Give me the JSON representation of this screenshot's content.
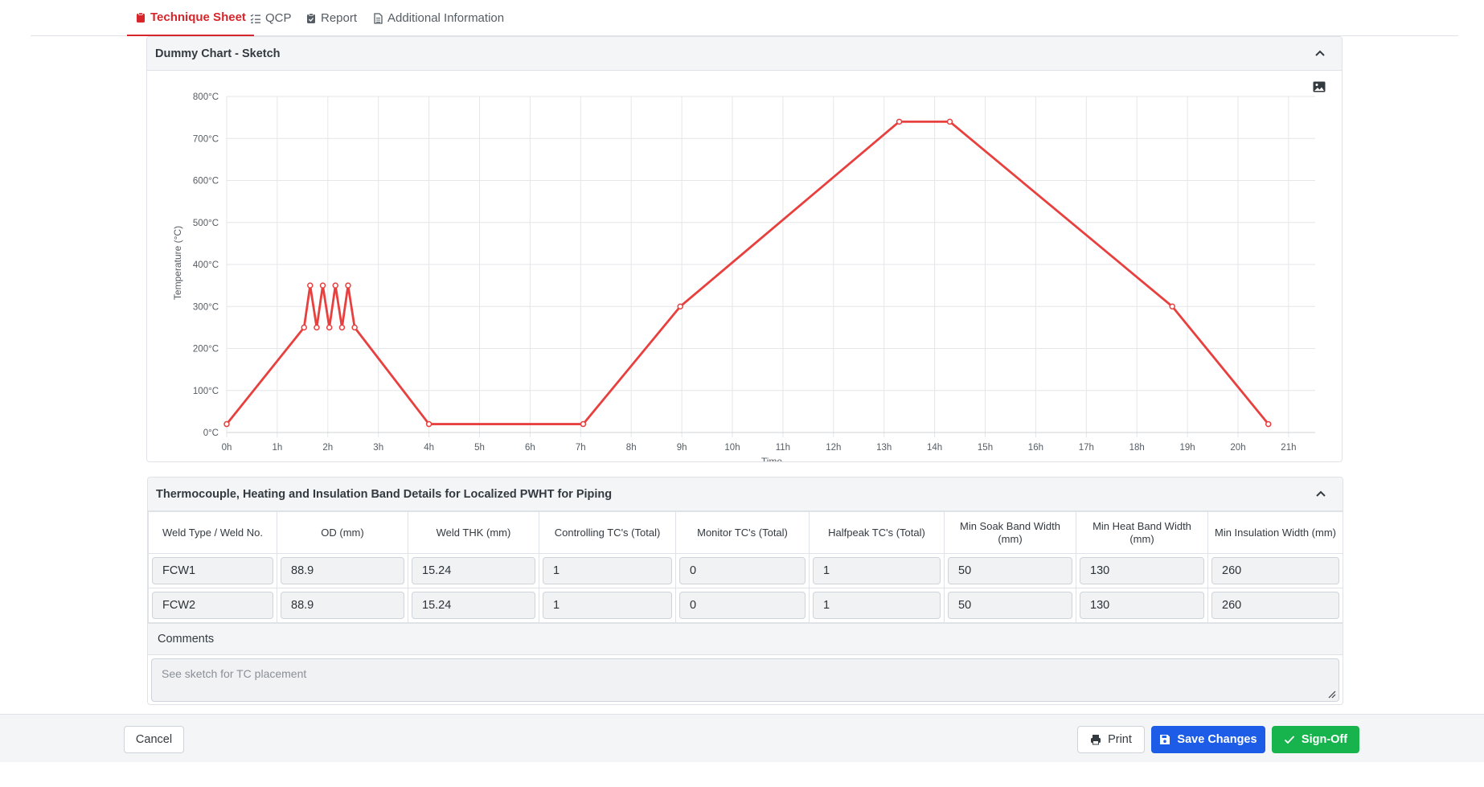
{
  "tabs": [
    {
      "label": "Technique Sheet",
      "icon": "clipboard-icon",
      "active": true
    },
    {
      "label": "QCP",
      "icon": "list-check-icon",
      "active": false
    },
    {
      "label": "Report",
      "icon": "clipboard-check-icon",
      "active": false
    },
    {
      "label": "Additional Information",
      "icon": "file-text-icon",
      "active": false
    }
  ],
  "chart_card": {
    "title": "Dummy Chart - Sketch"
  },
  "chart_data": {
    "type": "line",
    "title": "",
    "xlabel": "Time",
    "ylabel": "Temperature (°C)",
    "xlim": [
      0,
      21.6
    ],
    "ylim": [
      0,
      800
    ],
    "x_ticks": [
      "0h",
      "1h",
      "2h",
      "3h",
      "4h",
      "5h",
      "6h",
      "7h",
      "8h",
      "9h",
      "10h",
      "11h",
      "12h",
      "13h",
      "14h",
      "15h",
      "16h",
      "17h",
      "18h",
      "19h",
      "20h",
      "21h"
    ],
    "y_ticks": [
      "0°C",
      "100°C",
      "200°C",
      "300°C",
      "400°C",
      "500°C",
      "600°C",
      "700°C",
      "800°C"
    ],
    "grid": true,
    "color": "#e8403e",
    "series": [
      {
        "points": [
          [
            0,
            20
          ],
          [
            1.53,
            250
          ],
          [
            1.65,
            350
          ],
          [
            1.78,
            250
          ],
          [
            1.9,
            350
          ],
          [
            2.03,
            250
          ],
          [
            2.15,
            350
          ],
          [
            2.28,
            250
          ],
          [
            2.4,
            350
          ],
          [
            2.53,
            250
          ],
          [
            4.0,
            20
          ],
          [
            7.05,
            20
          ],
          [
            8.97,
            300
          ],
          [
            13.3,
            740
          ],
          [
            14.3,
            740
          ],
          [
            18.7,
            300
          ],
          [
            20.6,
            20
          ]
        ]
      }
    ]
  },
  "table_card": {
    "title": "Thermocouple, Heating and Insulation Band Details for Localized PWHT for Piping",
    "columns": [
      "Weld Type / Weld No.",
      "OD (mm)",
      "Weld THK (mm)",
      "Controlling TC's (Total)",
      "Monitor TC's (Total)",
      "Halfpeak TC's (Total)",
      "Min Soak Band Width (mm)",
      "Min Heat Band Width (mm)",
      "Min Insulation Width (mm)"
    ],
    "rows": [
      [
        "FCW1",
        "88.9",
        "15.24",
        "1",
        "0",
        "1",
        "50",
        "130",
        "260"
      ],
      [
        "FCW2",
        "88.9",
        "15.24",
        "1",
        "0",
        "1",
        "50",
        "130",
        "260"
      ]
    ],
    "comments_label": "Comments",
    "comments_placeholder": "See sketch for TC placement"
  },
  "footer": {
    "cancel_label": "Cancel",
    "print_label": "Print",
    "save_label": "Save Changes",
    "signoff_label": "Sign-Off"
  },
  "colors": {
    "accent": "#d7262b",
    "primary": "#1d5ce6",
    "success": "#17b44d"
  }
}
